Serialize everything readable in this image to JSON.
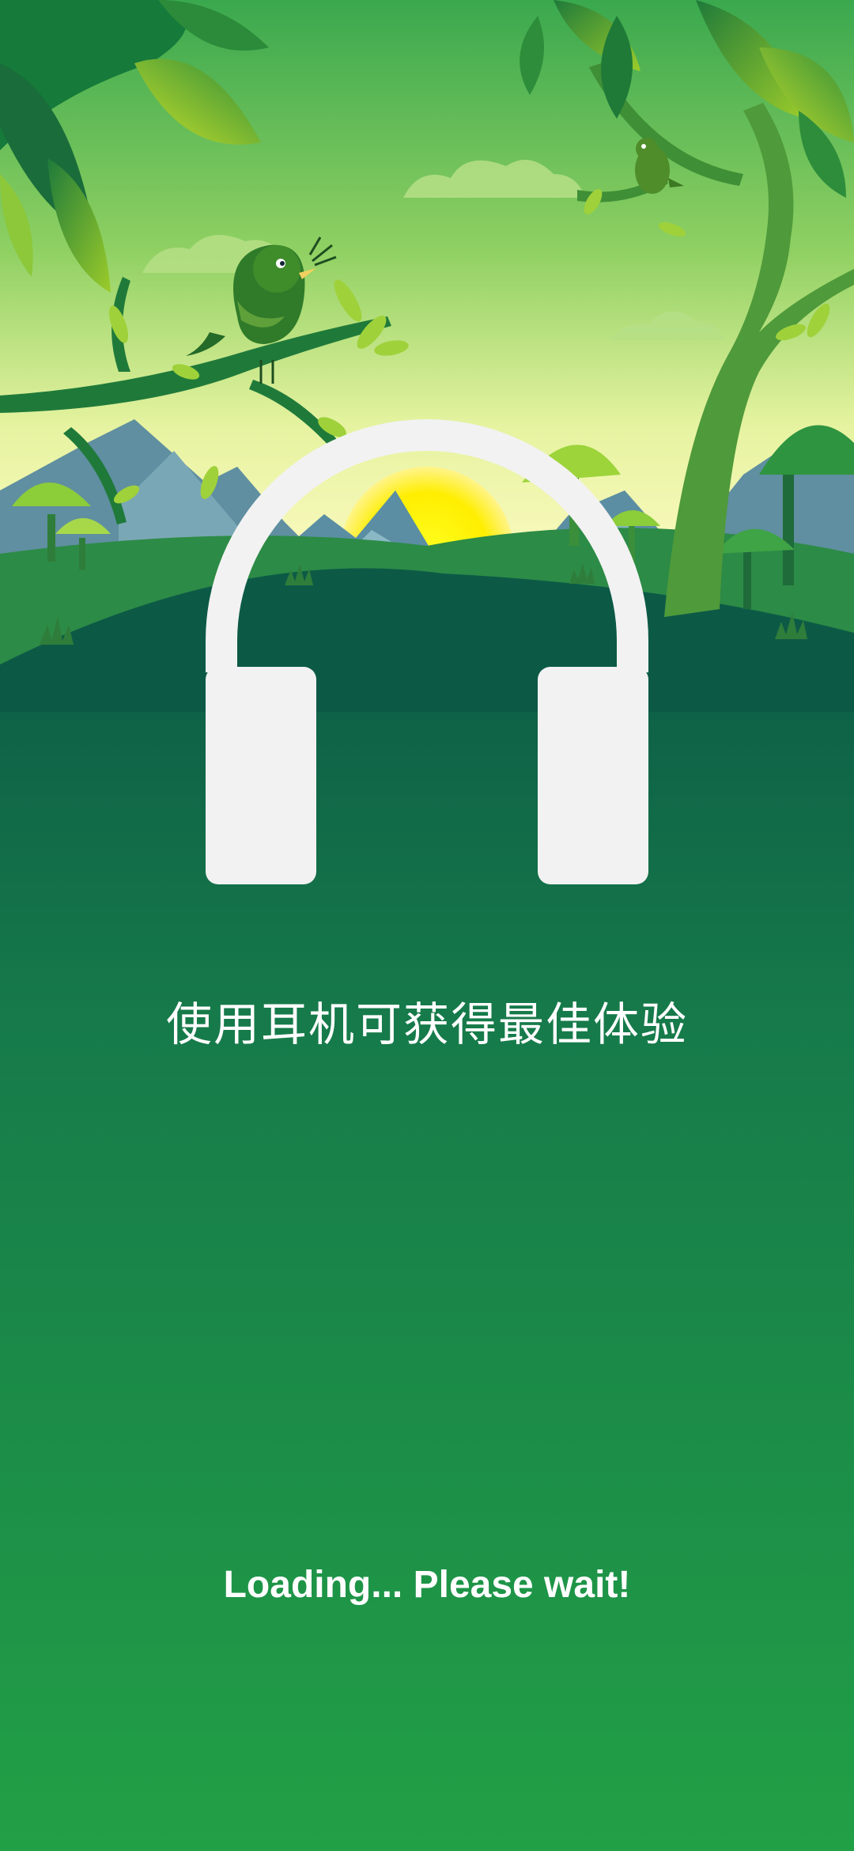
{
  "splash": {
    "tagline": "使用耳机可获得最佳体验",
    "loading_text": "Loading... Please wait!"
  },
  "illustration": {
    "icon": "headphones-icon",
    "theme": "forest-sunrise-with-birds",
    "colors": {
      "sky_top": "#3aa84e",
      "sky_bottom": "#f2f7b0",
      "sun": "#ffee00",
      "hill": "#0c5a46",
      "bottom": "#22a046",
      "headphones": "#f2f2f2"
    }
  }
}
